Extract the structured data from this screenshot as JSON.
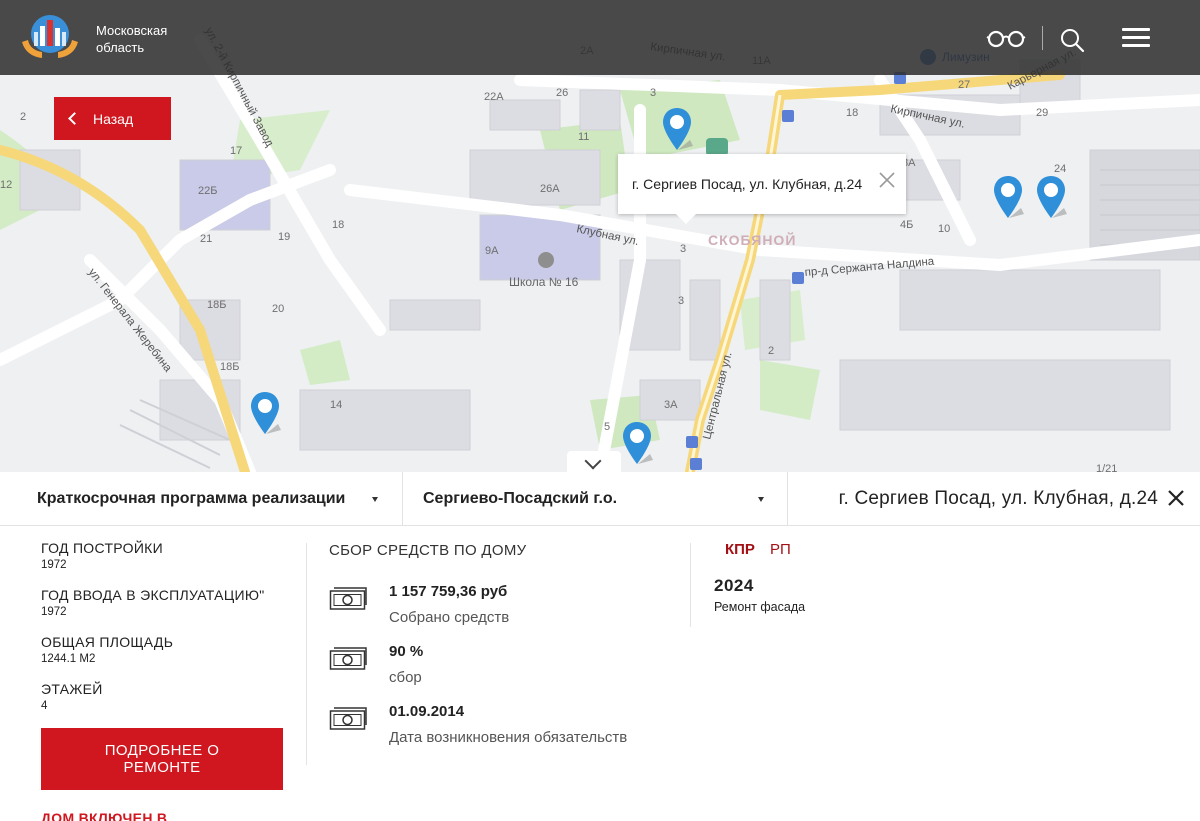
{
  "header": {
    "region_name": "Московская область",
    "icons": [
      "logo-icon",
      "glasses-icon",
      "search-icon",
      "menu-icon"
    ]
  },
  "back_button": {
    "label": "Назад"
  },
  "map": {
    "streets": [
      "ул. 2-й Кирпичный Завод",
      "Кирпичная ул.",
      "Кирпичная ул.",
      "Карьерная ул.",
      "Клубная ул.",
      "пр-д Сержанта Налдина",
      "ул. Генерала Жеребина",
      "Центральная ул."
    ],
    "labels": [
      "22А",
      "26",
      "2А",
      "11А",
      "11",
      "3",
      "17",
      "22Б",
      "26А",
      "9А",
      "21",
      "19",
      "18",
      "20",
      "18Б",
      "18Б",
      "14",
      "2",
      "27",
      "18",
      "8А",
      "4Б",
      "10",
      "24",
      "29",
      "3",
      "3",
      "3А",
      "5",
      "2",
      "1/21",
      "12",
      "2"
    ],
    "poi": {
      "school": "Школа № 16",
      "district": "СКОБЯНОЙ",
      "metro": "Лимузин"
    }
  },
  "popup": {
    "address": "г. Сергиев Посад, ул. Клубная, д.24"
  },
  "filters": {
    "program": "Краткосрочная программа реализации",
    "district": "Сергиево-Посадский г.о.",
    "address": "г. Сергиев Посад, ул. Клубная, д.24"
  },
  "building": {
    "attributes": [
      {
        "label": "ГОД ПОСТРОЙКИ",
        "value": "1972"
      },
      {
        "label": "ГОД ВВОДА В ЭКСПЛУАТАЦИЮ\"",
        "value": "1972"
      },
      {
        "label": "ОБЩАЯ ПЛОЩАДЬ",
        "value": "1244.1 М2"
      },
      {
        "label": "ЭТАЖЕЙ",
        "value": "4"
      }
    ],
    "details_button": "ПОДРОБНЕЕ О РЕМОНТЕ",
    "included_text": "ДОМ ВКЛЮЧЕН В"
  },
  "funds": {
    "title": "СБОР СРЕДСТВ ПО ДОМУ",
    "rows": [
      {
        "value": "1 157 759,36 руб",
        "label": "Собрано средств"
      },
      {
        "value": "90 %",
        "label": "сбор"
      },
      {
        "value": "01.09.2014",
        "label": "Дата возникновения обязательств"
      }
    ]
  },
  "repair": {
    "tabs": {
      "kpr": "КПР",
      "rp": "РП"
    },
    "year": "2024",
    "type": "Ремонт фасада"
  },
  "colors": {
    "accent": "#d0171f",
    "pin": "#2f8fd8",
    "header_bg": "#2d2d2d"
  }
}
